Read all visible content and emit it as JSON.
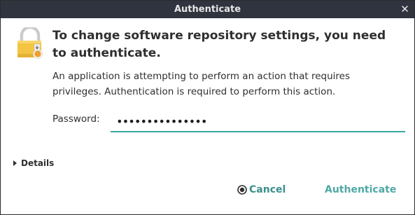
{
  "window": {
    "title": "Authenticate",
    "close_symbol": "✕"
  },
  "dialog": {
    "heading": "To change software repository settings, you need to authenticate.",
    "message": "An application is attempting to perform an action that requires privileges. Authentication is required to perform this action.",
    "password_label": "Password:",
    "password_value": "•••••••••••••••",
    "details_label": "Details",
    "cancel_label": "Cancel",
    "authenticate_label": "Authenticate"
  },
  "icons": {
    "lock": "lock-icon",
    "close": "close-icon",
    "cancel": "cancel-icon",
    "details": "disclosure-triangle-icon"
  },
  "colors": {
    "titlebar": "#2f343f",
    "accent": "#3aa7a3",
    "lock_body": "#f4c542",
    "text": "#2f2f2f"
  }
}
